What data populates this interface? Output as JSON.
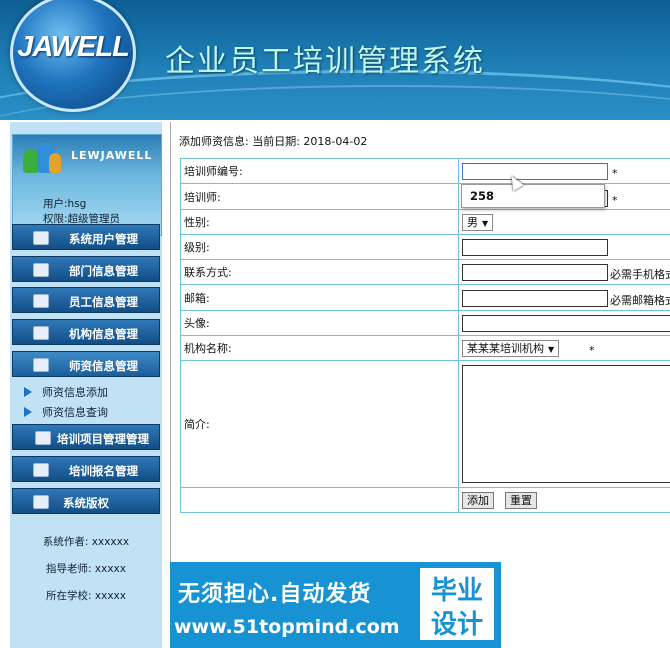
{
  "header": {
    "logo_text": "JAWELL",
    "system_title": "企业员工培训管理系统"
  },
  "sidebar": {
    "brand": "LEWJAWELL",
    "user_line": "用户:hsg",
    "role_line": "权限:超级管理员",
    "menu": [
      {
        "label": "系统用户管理"
      },
      {
        "label": "部门信息管理"
      },
      {
        "label": "员工信息管理"
      },
      {
        "label": "机构信息管理"
      },
      {
        "label": "师资信息管理"
      },
      {
        "label": "培训项目管理管理"
      },
      {
        "label": "培训报名管理"
      },
      {
        "label": "系统版权"
      }
    ],
    "submenu": [
      {
        "label": "师资信息添加"
      },
      {
        "label": "师资信息查询"
      }
    ],
    "author_line": "系统作者: xxxxxx",
    "advisor_line": "指导老师: xxxxx",
    "school_line": "所在学校: xxxxx"
  },
  "main": {
    "info_line": "添加师资信息:   当前日期:   2018-04-02",
    "form": {
      "teacher_id_label": "培训师编号:",
      "teacher_id_value": "",
      "teacher_name_label": "培训师:",
      "gender_label": "性别:",
      "gender_value": "男",
      "level_label": "级别:",
      "contact_label": "联系方式:",
      "contact_hint": "必需手机格式",
      "email_label": "邮箱:",
      "email_hint": "必需邮箱格式",
      "avatar_label": "头像:",
      "org_label": "机构名称:",
      "org_value": "某某某培训机构",
      "intro_label": "简介:",
      "required_mark": "*",
      "add_button": "添加",
      "reset_button": "重置"
    },
    "autocomplete_value": "258"
  },
  "banner": {
    "line1": "无须担心.自动发货",
    "line2": "www.51topmind.com",
    "box_line1": "毕业",
    "box_line2": "设计"
  }
}
